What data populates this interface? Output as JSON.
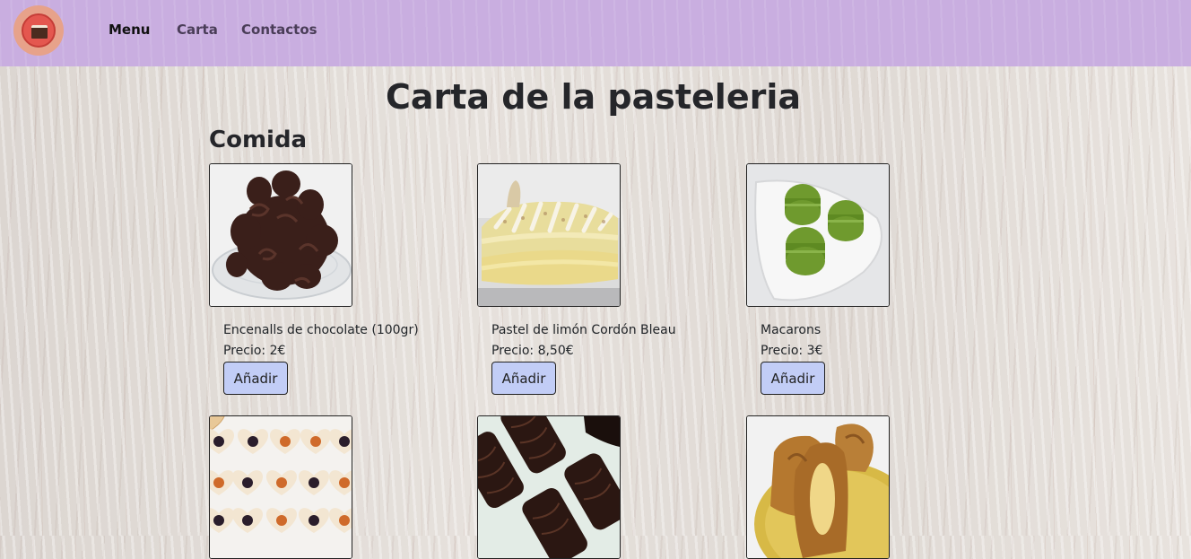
{
  "nav": {
    "links": [
      {
        "label": "Menu",
        "active": true
      },
      {
        "label": "Carta",
        "active": false
      },
      {
        "label": "Contactos",
        "active": false
      }
    ]
  },
  "page_title": "Carta de la pasteleria",
  "section_title": "Comida",
  "products": [
    {
      "name": "Encenalls de chocolate (100gr)",
      "price": "Precio: 2€",
      "button": "Añadir",
      "image": "chocolate-curls-photo"
    },
    {
      "name": "Pastel de limón Cordón Bleau",
      "price": "Precio: 8,50€",
      "button": "Añadir",
      "image": "lemon-cake-photo"
    },
    {
      "name": "Macarons",
      "price": "Precio: 3€",
      "button": "Añadir",
      "image": "green-macarons-photo"
    },
    {
      "image": "heart-jam-cookies-photo"
    },
    {
      "image": "chocolate-bars-photo"
    },
    {
      "image": "muffin-loaves-photo"
    }
  ],
  "colors": {
    "navbar": "#c9aee0",
    "button": "#c2cdf6",
    "text": "#212529"
  }
}
